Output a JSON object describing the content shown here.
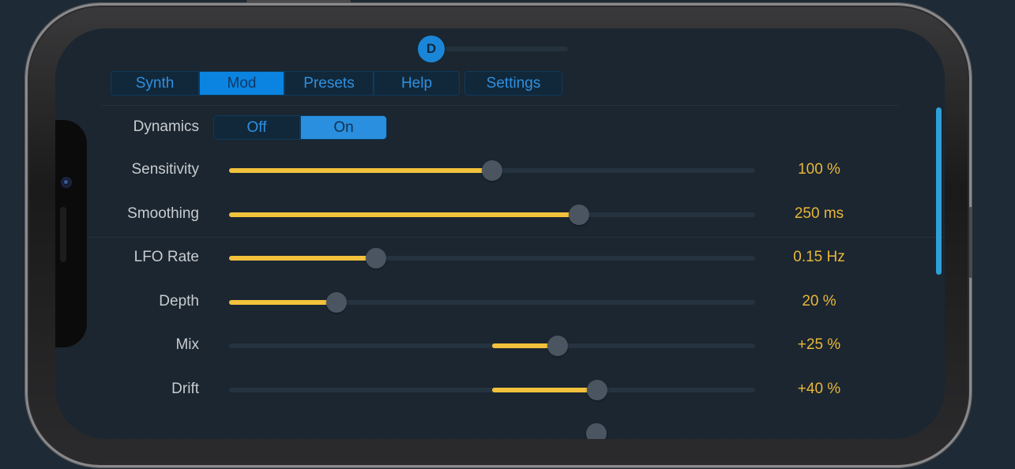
{
  "page_indicator": {
    "letter": "D"
  },
  "tabs": [
    {
      "label": "Synth",
      "active": false
    },
    {
      "label": "Mod",
      "active": true
    },
    {
      "label": "Presets",
      "active": false
    },
    {
      "label": "Help",
      "active": false
    }
  ],
  "settings_tab": {
    "label": "Settings"
  },
  "dynamics": {
    "label": "Dynamics",
    "off_label": "Off",
    "on_label": "On",
    "selected": "On"
  },
  "params": [
    {
      "label": "Sensitivity",
      "value": "100 %",
      "fill_start": 0.0,
      "fill_end": 0.5,
      "thumb": 0.5
    },
    {
      "label": "Smoothing",
      "value": "250 ms",
      "fill_start": 0.0,
      "fill_end": 0.665,
      "thumb": 0.665
    },
    {
      "label": "LFO Rate",
      "value": "0.15 Hz",
      "fill_start": 0.0,
      "fill_end": 0.28,
      "thumb": 0.28
    },
    {
      "label": "Depth",
      "value": "20 %",
      "fill_start": 0.0,
      "fill_end": 0.204,
      "thumb": 0.204
    },
    {
      "label": "Mix",
      "value": "+25 %",
      "fill_start": 0.5,
      "fill_end": 0.625,
      "thumb": 0.625
    },
    {
      "label": "Drift",
      "value": "+40 %",
      "fill_start": 0.5,
      "fill_end": 0.7,
      "thumb": 0.7
    }
  ],
  "colors": {
    "accent_blue": "#0a84e0",
    "slider_fill": "#f3c23c",
    "value_text": "#e9b73a",
    "label_text": "#c8ccd0",
    "background": "#1b2630"
  }
}
